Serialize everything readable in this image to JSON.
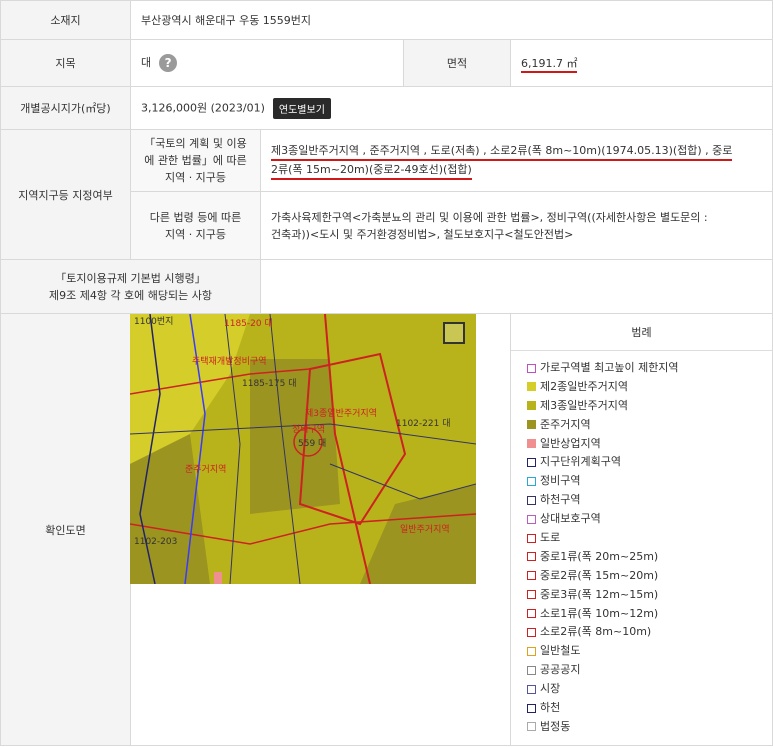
{
  "rows": {
    "location": {
      "label": "소재지",
      "value": "부산광역시 해운대구 우동 1559번지"
    },
    "land_category": {
      "label": "지목",
      "value": "대",
      "help_icon": "question-icon"
    },
    "area": {
      "label": "면적",
      "value": "6,191.7 ㎡"
    },
    "official_price": {
      "label": "개별공시지가(㎡당)",
      "value": "3,126,000원 (2023/01)",
      "button": "연도별보기"
    },
    "zoning": {
      "label": "지역지구등 지정여부",
      "national_law": {
        "label_lines": [
          "「국토의 계획 및 이용",
          "에 관한 법률」에 따른",
          "지역 · 지구등"
        ],
        "value_lines": [
          "제3종일반주거지역 , 준주거지역 , 도로(저촉) , 소로2류(폭 8m~10m)(1974.05.13)(접합) , 중로",
          "2류(폭 15m~20m)(중로2-49호선)(접합)"
        ]
      },
      "other_law": {
        "label_lines": [
          "다른 법령 등에 따른",
          "지역 · 지구등"
        ],
        "value_lines": [
          "가축사육제한구역<가축분뇨의 관리 및 이용에 관한 법률>, 정비구역((자세한사항은 별도문의 :",
          "건축과))<도시 및 주거환경정비법>, 철도보호지구<철도안전법>"
        ]
      }
    },
    "enforcement": {
      "label_lines": [
        "「토지이용규제 기본법 시행령」",
        "제9조 제4항 각 호에 해당되는 사항"
      ],
      "value": ""
    },
    "map": {
      "label": "확인도면"
    }
  },
  "map_labels": [
    "1100번지",
    "1185-20 대",
    "주택재개발정비구역",
    "1185-175 대",
    "제3종일반주거지역",
    "정비구역",
    "559 대",
    "1102-221 대",
    "준주거지역",
    "1102-203",
    "일반주거지역"
  ],
  "legend": {
    "title": "범례",
    "items": [
      {
        "label": "가로구역별 최고높이 제한지역",
        "color": "#c24fc2",
        "filled": false
      },
      {
        "label": "제2종일반주거지역",
        "color": "#d4cd2a",
        "filled": true
      },
      {
        "label": "제3종일반주거지역",
        "color": "#b9b31b",
        "filled": true
      },
      {
        "label": "준주거지역",
        "color": "#9c9420",
        "filled": true
      },
      {
        "label": "일반상업지역",
        "color": "#ef8f8f",
        "filled": true
      },
      {
        "label": "지구단위계획구역",
        "color": "#23236b",
        "filled": false
      },
      {
        "label": "정비구역",
        "color": "#2aa9d6",
        "filled": false
      },
      {
        "label": "하천구역",
        "color": "#333366",
        "filled": false
      },
      {
        "label": "상대보호구역",
        "color": "#b65fbf",
        "filled": false
      },
      {
        "label": "도로",
        "color": "#cc2222",
        "filled": false
      },
      {
        "label": "중로1류(폭 20m~25m)",
        "color": "#cc2222",
        "filled": false
      },
      {
        "label": "중로2류(폭 15m~20m)",
        "color": "#cc2222",
        "filled": false
      },
      {
        "label": "중로3류(폭 12m~15m)",
        "color": "#cc2222",
        "filled": false
      },
      {
        "label": "소로1류(폭 10m~12m)",
        "color": "#cc2222",
        "filled": false
      },
      {
        "label": "소로2류(폭 8m~10m)",
        "color": "#cc2222",
        "filled": false
      },
      {
        "label": "일반철도",
        "color": "#e0a020",
        "filled": false
      },
      {
        "label": "공공공지",
        "color": "#888888",
        "filled": false
      },
      {
        "label": "시장",
        "color": "#555599",
        "filled": false
      },
      {
        "label": "하천",
        "color": "#222266",
        "filled": false
      },
      {
        "label": "법정동",
        "color": "#aaaaaa",
        "filled": false
      }
    ]
  }
}
